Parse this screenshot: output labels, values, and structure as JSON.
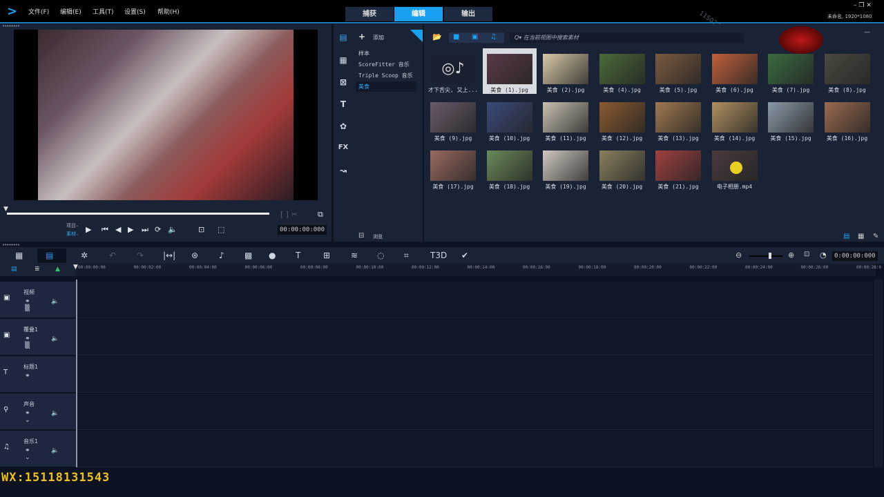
{
  "menu": [
    "文件(F)",
    "编辑(E)",
    "工具(T)",
    "设置(S)",
    "帮助(H)"
  ],
  "tabs": [
    {
      "label": "捕获",
      "active": false
    },
    {
      "label": "编辑",
      "active": true
    },
    {
      "label": "输出",
      "active": false
    }
  ],
  "window": {
    "project_info": "未命名, 1920*1080",
    "watermark": "1150271395"
  },
  "preview": {
    "mode_project": "项目–",
    "mode_clip": "素材–",
    "timecode": "00:00:00:000",
    "progress": 0
  },
  "library": {
    "add_label": "添加",
    "search_placeholder": "在当前视图中搜索素材",
    "browse_label": "浏览",
    "folders": [
      {
        "label": "样本",
        "selected": false
      },
      {
        "label": "ScoreFitter 音乐",
        "selected": false
      },
      {
        "label": "Triple Scoop 音乐",
        "selected": false
      },
      {
        "label": "美食",
        "selected": true
      }
    ],
    "items": [
      {
        "label": "才下舌尖, 又上...",
        "type": "audio",
        "color": "#1a2030"
      },
      {
        "label": "美食 (1).jpg",
        "color": "#5a3a48",
        "selected": true
      },
      {
        "label": "美食 (2).jpg",
        "color": "#d8c8a8"
      },
      {
        "label": "美食 (4).jpg",
        "color": "#4a6a3a"
      },
      {
        "label": "美食 (5).jpg",
        "color": "#7a5a40"
      },
      {
        "label": "美食 (6).jpg",
        "color": "#c0603a"
      },
      {
        "label": "美食 (7).jpg",
        "color": "#3a6a40"
      },
      {
        "label": "美食 (8).jpg",
        "color": "#4a4a40"
      },
      {
        "label": "美食 (9).jpg",
        "color": "#6a5a6a"
      },
      {
        "label": "美食 (10).jpg",
        "color": "#3a4a7a"
      },
      {
        "label": "美食 (11).jpg",
        "color": "#c8c0b0"
      },
      {
        "label": "美食 (12).jpg",
        "color": "#8a5a30"
      },
      {
        "label": "美食 (13).jpg",
        "color": "#a07850"
      },
      {
        "label": "美食 (14).jpg",
        "color": "#b09060"
      },
      {
        "label": "美食 (15).jpg",
        "color": "#8a9aa8"
      },
      {
        "label": "美食 (16).jpg",
        "color": "#9a6a50"
      },
      {
        "label": "美食 (17).jpg",
        "color": "#9a6a60"
      },
      {
        "label": "美食 (18).jpg",
        "color": "#6a8a5a"
      },
      {
        "label": "美食 (19).jpg",
        "color": "#d0c8c0"
      },
      {
        "label": "美食 (20).jpg",
        "color": "#8a8060"
      },
      {
        "label": "美食 (21).jpg",
        "color": "#a04040"
      },
      {
        "label": "电子相册.mp4",
        "type": "video",
        "color": "#4a3a40"
      }
    ]
  },
  "timeline": {
    "timecode": "0:00:00:000",
    "ruler": [
      "00:00:00:00",
      "00:00:02:00",
      "00:00:04:00",
      "00:00:06:00",
      "00:00:08:00",
      "00:00:10:00",
      "00:00:12:00",
      "00:00:14:00",
      "00:00:16:00",
      "00:00:18:00",
      "00:00:20:00",
      "00:00:22:00",
      "00:00:24:00",
      "00:00:26:00",
      "00:00:28:0"
    ],
    "tracks": [
      {
        "name": "视频",
        "icon": "video-track-icon"
      },
      {
        "name": "覆叠1",
        "icon": "overlay-track-icon"
      },
      {
        "name": "标题1",
        "icon": "title-track-icon"
      },
      {
        "name": "声音",
        "icon": "voice-track-icon"
      },
      {
        "name": "音乐1",
        "icon": "music-track-icon"
      }
    ]
  },
  "overlay_text": "WX:15118131543",
  "colors": {
    "accent": "#1aa0f0",
    "overlay": "#f0c020"
  }
}
